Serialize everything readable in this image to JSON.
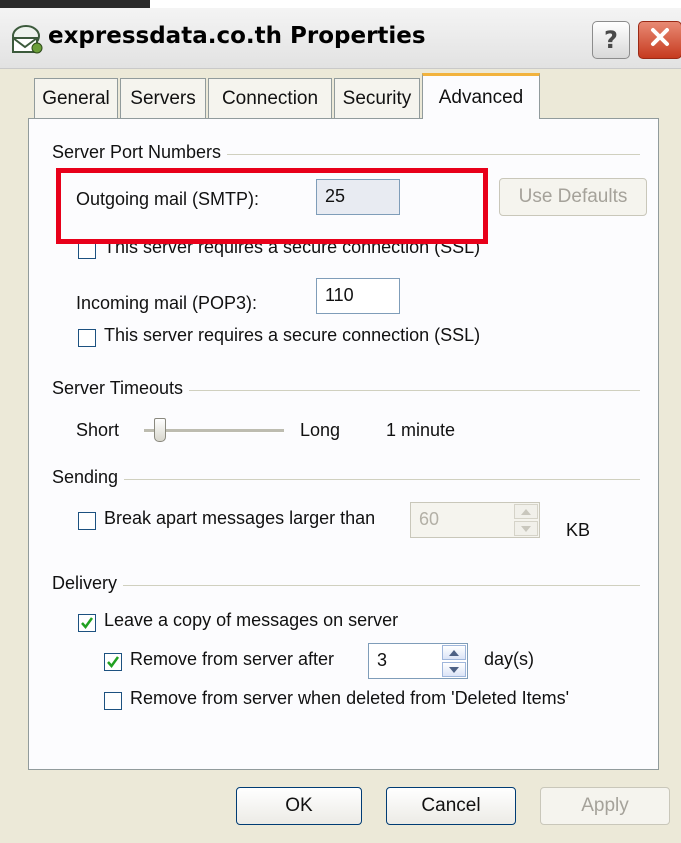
{
  "window": {
    "title": "expressdata.co.th Properties"
  },
  "titlebar_buttons": {
    "help": "?",
    "close_icon": "close-icon"
  },
  "tabs": [
    "General",
    "Servers",
    "Connection",
    "Security",
    "Advanced"
  ],
  "active_tab": "Advanced",
  "server_ports": {
    "group_label": "Server Port Numbers",
    "outgoing_label": "Outgoing mail (SMTP):",
    "outgoing_value": "25",
    "use_defaults": "Use Defaults",
    "ssl_outgoing_label": "This server requires a secure connection (SSL)",
    "ssl_outgoing_checked": false,
    "incoming_label": "Incoming mail (POP3):",
    "incoming_value": "110",
    "ssl_incoming_label": "This server requires a secure connection (SSL)",
    "ssl_incoming_checked": false
  },
  "timeouts": {
    "group_label": "Server Timeouts",
    "short_label": "Short",
    "long_label": "Long",
    "value_text": "1 minute",
    "slider_level": 0.08
  },
  "sending": {
    "group_label": "Sending",
    "break_apart_label": "Break apart messages larger than",
    "break_apart_checked": false,
    "size_value": "60",
    "unit": "KB"
  },
  "delivery": {
    "group_label": "Delivery",
    "leave_copy_label": "Leave a copy of messages on server",
    "leave_copy_checked": true,
    "remove_after_label": "Remove from server after",
    "remove_after_checked": true,
    "remove_after_value": "3",
    "remove_after_unit": "day(s)",
    "remove_deleted_label": "Remove from server when deleted from 'Deleted Items'",
    "remove_deleted_checked": false
  },
  "footer": {
    "ok": "OK",
    "cancel": "Cancel",
    "apply": "Apply"
  },
  "colors": {
    "highlight": "#e8001a",
    "active_tab_accent": "#f2b33d",
    "window_bg": "#ece9d8"
  }
}
